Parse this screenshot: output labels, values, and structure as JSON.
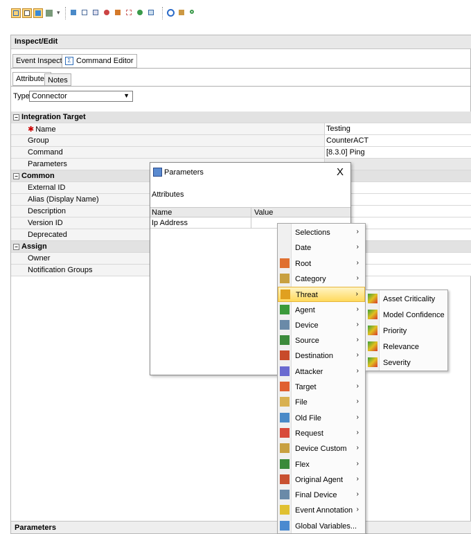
{
  "panel": {
    "title": "Inspect/Edit",
    "tabs": [
      "Event Inspector",
      "Command Editor"
    ],
    "subtabs": [
      "Attributes",
      "Notes"
    ],
    "type_label": "Type",
    "type_value": "Connector",
    "bottom_label": "Parameters"
  },
  "sections": {
    "integration": "Integration Target",
    "common": "Common",
    "assign": "Assign"
  },
  "rows": {
    "name": {
      "label": "Name",
      "value": "Testing"
    },
    "group": {
      "label": "Group",
      "value": "CounterACT"
    },
    "command": {
      "label": "Command",
      "value": "[8.3.0] Ping"
    },
    "parameters": {
      "label": "Parameters"
    },
    "external_id": {
      "label": "External ID"
    },
    "alias": {
      "label": "Alias (Display Name)"
    },
    "description": {
      "label": "Description"
    },
    "version_id": {
      "label": "Version ID"
    },
    "deprecated": {
      "label": "Deprecated"
    },
    "owner": {
      "label": "Owner"
    },
    "notification_groups": {
      "label": "Notification Groups"
    }
  },
  "dialog": {
    "title": "Parameters",
    "close": "X",
    "attributes": "Attributes",
    "col_name": "Name",
    "col_value": "Value",
    "row_name": "Ip Address"
  },
  "context_menu": {
    "items": [
      {
        "label": "Selections",
        "icon": "none"
      },
      {
        "label": "Date",
        "icon": "none"
      },
      {
        "label": "Root",
        "icon": "root-icon"
      },
      {
        "label": "Category",
        "icon": "category-icon"
      },
      {
        "label": "Threat",
        "icon": "threat-icon"
      },
      {
        "label": "Agent",
        "icon": "agent-icon"
      },
      {
        "label": "Device",
        "icon": "device-icon"
      },
      {
        "label": "Source",
        "icon": "source-icon"
      },
      {
        "label": "Destination",
        "icon": "destination-icon"
      },
      {
        "label": "Attacker",
        "icon": "attacker-icon"
      },
      {
        "label": "Target",
        "icon": "target-icon"
      },
      {
        "label": "File",
        "icon": "file-icon"
      },
      {
        "label": "Old File",
        "icon": "old-file-icon"
      },
      {
        "label": "Request",
        "icon": "request-icon"
      },
      {
        "label": "Device Custom",
        "icon": "device-custom-icon"
      },
      {
        "label": "Flex",
        "icon": "flex-icon"
      },
      {
        "label": "Original Agent",
        "icon": "original-agent-icon"
      },
      {
        "label": "Final Device",
        "icon": "final-device-icon"
      },
      {
        "label": "Event Annotation",
        "icon": "event-annotation-icon"
      },
      {
        "label": "Global Variables...",
        "icon": "global-variables-icon"
      }
    ],
    "arrow": "›"
  },
  "threat_submenu": {
    "items": [
      "Asset Criticality",
      "Model Confidence",
      "Priority",
      "Relevance",
      "Severity"
    ]
  },
  "colors": {
    "highlight": "#ffd95c",
    "section_bg": "#e2e2e2",
    "required": "#cc0000"
  }
}
